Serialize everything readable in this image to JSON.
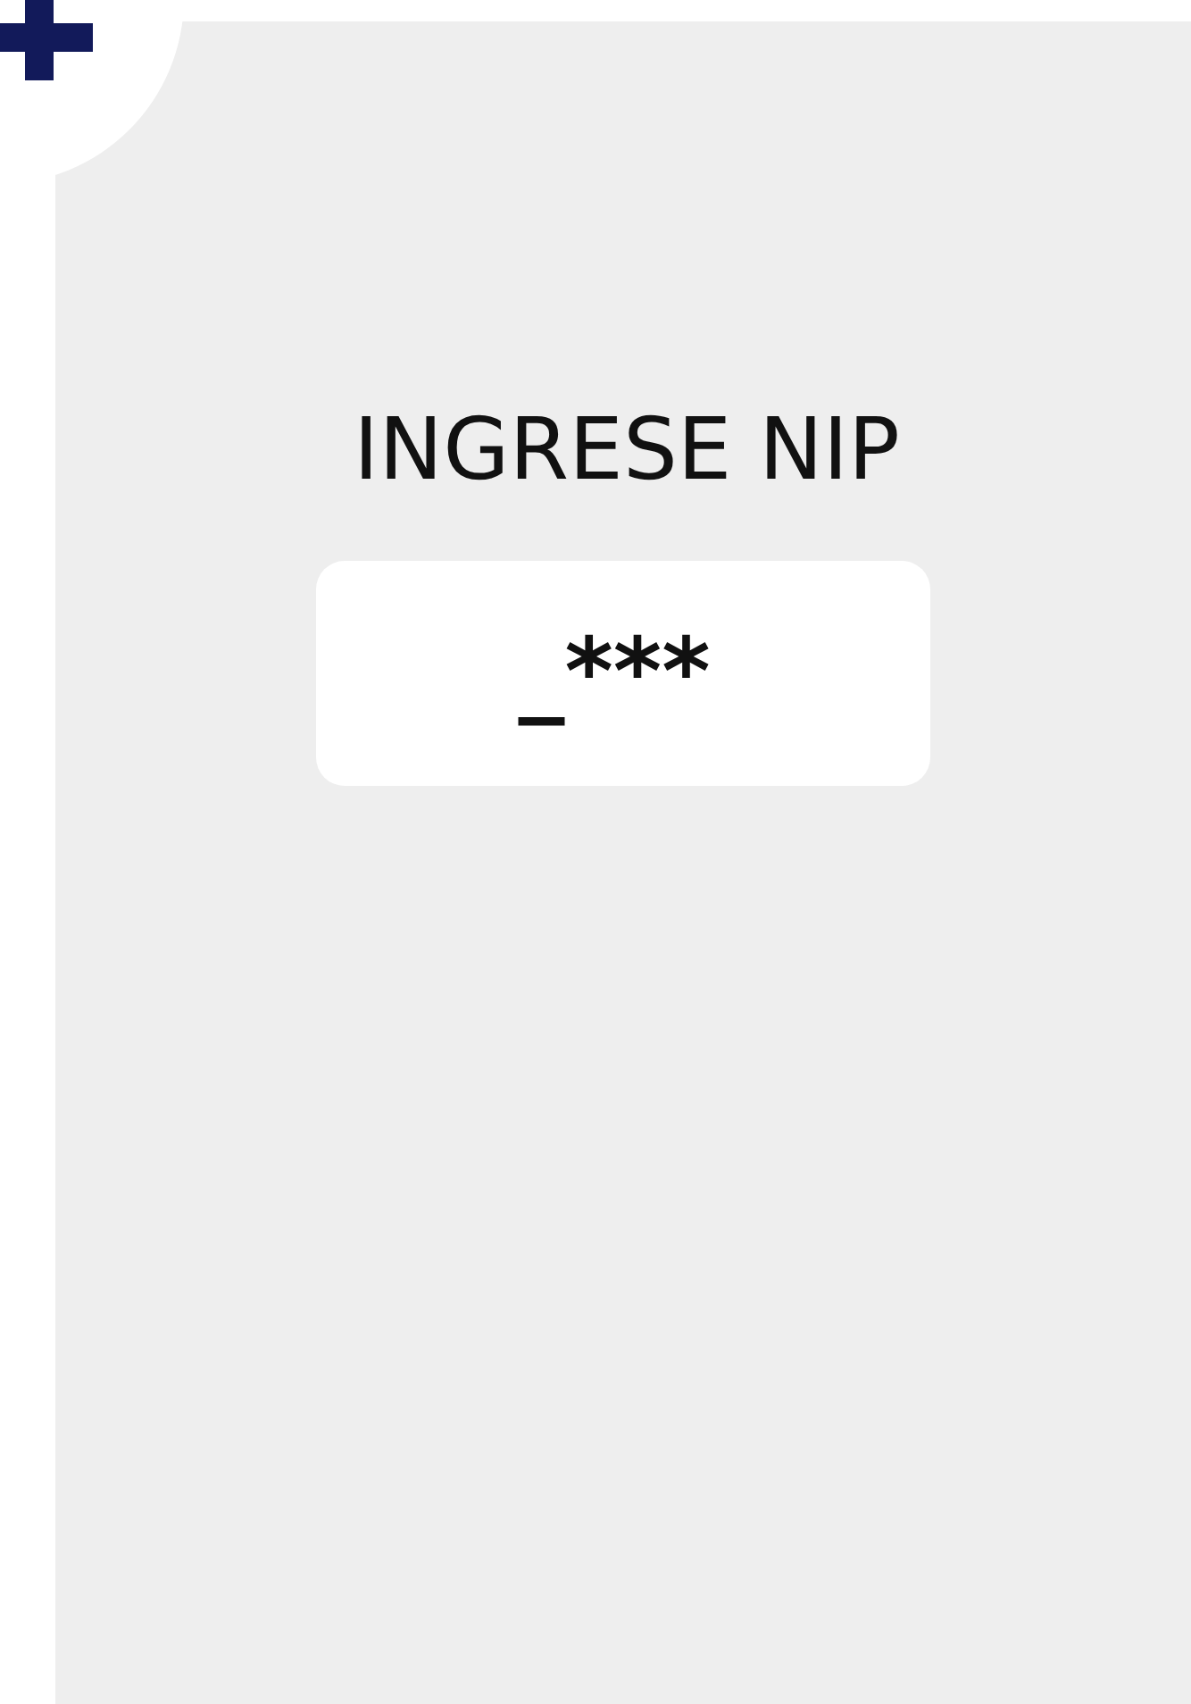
{
  "title": "INGRESE NIP",
  "pin_field": {
    "value": "_***"
  }
}
